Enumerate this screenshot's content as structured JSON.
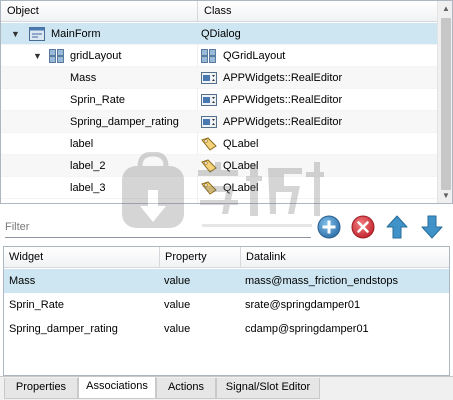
{
  "object_inspector": {
    "headers": {
      "object": "Object",
      "class": "Class"
    },
    "rows": [
      {
        "name": "MainForm",
        "class": "QDialog",
        "icon": "dialog-icon",
        "arrow": "▼",
        "selected": true
      },
      {
        "name": "gridLayout",
        "class": "QGridLayout",
        "icon": "grid-layout-icon",
        "arrow": "▼",
        "selected": false
      },
      {
        "name": "Mass",
        "class": "APPWidgets::RealEditor",
        "icon": "real-editor-icon",
        "arrow": "",
        "selected": false
      },
      {
        "name": "Sprin_Rate",
        "class": "APPWidgets::RealEditor",
        "icon": "real-editor-icon",
        "arrow": "",
        "selected": false
      },
      {
        "name": "Spring_damper_rating",
        "class": "APPWidgets::RealEditor",
        "icon": "real-editor-icon",
        "arrow": "",
        "selected": false
      },
      {
        "name": "label",
        "class": "QLabel",
        "icon": "label-tag-icon",
        "arrow": "",
        "selected": false
      },
      {
        "name": "label_2",
        "class": "QLabel",
        "icon": "label-tag-icon",
        "arrow": "",
        "selected": false
      },
      {
        "name": "label_3",
        "class": "QLabel",
        "icon": "label-tag-icon",
        "arrow": "",
        "selected": false
      }
    ]
  },
  "toolbar": {
    "filter_placeholder": "Filter",
    "add_icon": "plus-circle-icon",
    "remove_icon": "remove-circle-icon",
    "up_icon": "arrow-up-icon",
    "down_icon": "arrow-down-icon"
  },
  "associations": {
    "headers": {
      "widget": "Widget",
      "property": "Property",
      "datalink": "Datalink"
    },
    "rows": [
      {
        "widget": "Mass",
        "property": "value",
        "datalink": "mass@mass_friction_endstops",
        "selected": true
      },
      {
        "widget": "Sprin_Rate",
        "property": "value",
        "datalink": "srate@springdamper01",
        "selected": false
      },
      {
        "widget": "Spring_damper_rating",
        "property": "value",
        "datalink": "cdamp@springdamper01",
        "selected": false
      }
    ]
  },
  "tabs": [
    {
      "label": "Properties",
      "active": false
    },
    {
      "label": "Associations",
      "active": true
    },
    {
      "label": "Actions",
      "active": false
    },
    {
      "label": "Signal/Slot Editor",
      "active": false
    }
  ],
  "watermark": {
    "text": "安下载",
    "subtext": "anxz.com"
  },
  "colors": {
    "selection": "#cde6f1",
    "add_button": "#3a87c4",
    "remove_button": "#d9343a",
    "arrow_button": "#3f93c9"
  }
}
